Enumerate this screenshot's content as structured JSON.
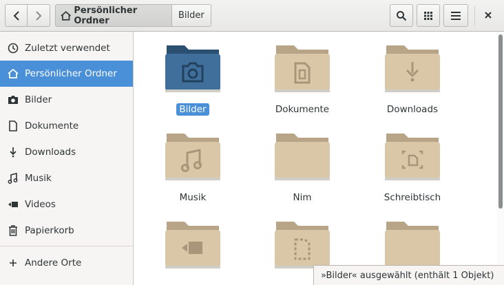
{
  "header": {
    "path": [
      {
        "label": "Persönlicher Ordner",
        "icon": "home-icon"
      },
      {
        "label": "Bilder"
      }
    ]
  },
  "sidebar": {
    "items": [
      {
        "label": "Zuletzt verwendet",
        "icon": "clock-icon"
      },
      {
        "label": "Persönlicher Ordner",
        "icon": "home-icon",
        "active": true
      },
      {
        "label": "Bilder",
        "icon": "camera-icon"
      },
      {
        "label": "Dokumente",
        "icon": "document-icon"
      },
      {
        "label": "Downloads",
        "icon": "download-icon"
      },
      {
        "label": "Musik",
        "icon": "music-icon"
      },
      {
        "label": "Videos",
        "icon": "video-icon"
      },
      {
        "label": "Papierkorb",
        "icon": "trash-icon"
      }
    ],
    "other_locations": {
      "label": "Andere Orte",
      "icon": "plus-icon"
    }
  },
  "files": [
    {
      "name": "Bilder",
      "icon": "camera-icon",
      "selected": true
    },
    {
      "name": "Dokumente",
      "icon": "document-icon"
    },
    {
      "name": "Downloads",
      "icon": "download-icon"
    },
    {
      "name": "Musik",
      "icon": "music-icon"
    },
    {
      "name": "Nim",
      "icon": "none"
    },
    {
      "name": "Schreibtisch",
      "icon": "desktop-icon"
    },
    {
      "name": "",
      "icon": "video-icon"
    },
    {
      "name": "",
      "icon": "template-icon"
    },
    {
      "name": "",
      "icon": "none"
    }
  ],
  "status": {
    "text": "»Bilder« ausgewählt  (enthält 1 Objekt)"
  },
  "colors": {
    "accent": "#4a90d9",
    "folder": "#d9c7a8",
    "folder_selected": "#3f6f9a"
  }
}
